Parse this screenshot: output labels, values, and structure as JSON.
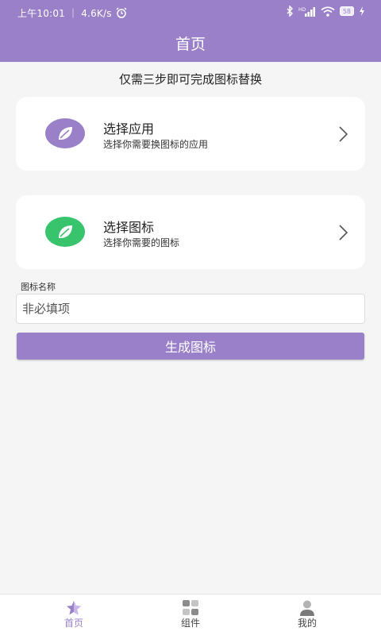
{
  "status_bar": {
    "time": "上午10:01",
    "speed": "4.6K/s",
    "battery": "58"
  },
  "header": {
    "title": "首页"
  },
  "subtitle": "仅需三步即可完成图标替换",
  "cards": [
    {
      "title": "选择应用",
      "subtitle": "选择你需要换图标的应用",
      "icon": "leaf-icon",
      "color": "#9a80c9"
    },
    {
      "title": "选择图标",
      "subtitle": "选择你需要的图标",
      "icon": "leaf-icon",
      "color": "#37c46c"
    }
  ],
  "icon_name": {
    "label": "图标名称",
    "placeholder": "非必填项",
    "value": ""
  },
  "generate_button": {
    "label": "生成图标"
  },
  "tabs": [
    {
      "label": "首页",
      "icon": "star-icon",
      "active": true
    },
    {
      "label": "组件",
      "icon": "grid-icon",
      "active": false
    },
    {
      "label": "我的",
      "icon": "user-icon",
      "active": false
    }
  ],
  "colors": {
    "accent": "#9a80c9",
    "green": "#37c46c",
    "background": "#f5f5f5"
  }
}
